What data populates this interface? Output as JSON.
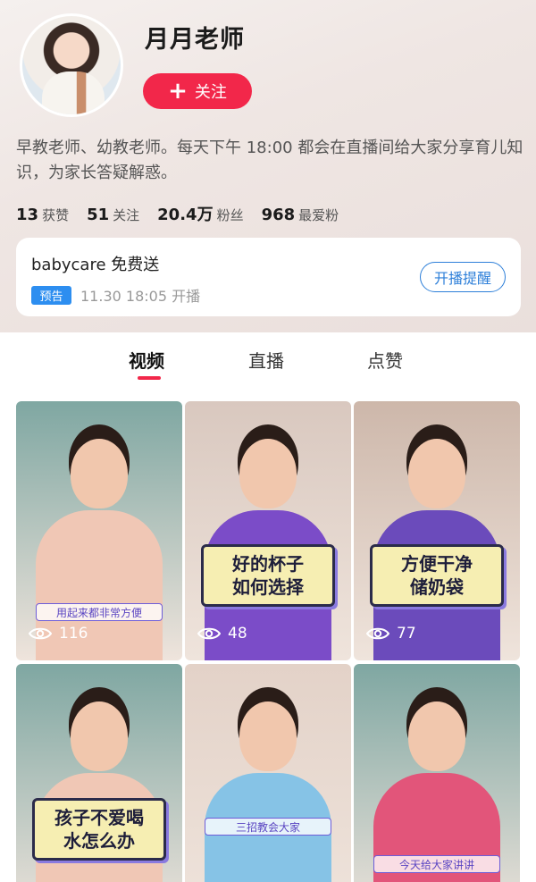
{
  "profile": {
    "name": "月月老师",
    "follow_label": "关注",
    "bio": "早教老师、幼教老师。每天下午 18:00 都会在直播间给大家分享育儿知识，为家长答疑解惑。",
    "stats": [
      {
        "value": "13",
        "label": "获赞"
      },
      {
        "value": "51",
        "label": "关注"
      },
      {
        "value": "20.4万",
        "label": "粉丝"
      },
      {
        "value": "968",
        "label": "最爱粉"
      }
    ]
  },
  "live": {
    "title": "babycare 免费送",
    "badge": "预告",
    "time": "11.30 18:05 开播",
    "remind_label": "开播提醒"
  },
  "tabs": [
    {
      "label": "视频",
      "active": true
    },
    {
      "label": "直播",
      "active": false
    },
    {
      "label": "点赞",
      "active": false
    }
  ],
  "videos": [
    {
      "caption": "",
      "small_caption": "用起来都非常方便",
      "views": "116",
      "bg": "#7fa7a2",
      "torso": "#f0c7b5"
    },
    {
      "caption": "好的杯子\n如何选择",
      "small_caption": "",
      "views": "48",
      "bg": "#d9c8bf",
      "torso": "#7b4cc8"
    },
    {
      "caption": "方便干净\n储奶袋",
      "small_caption": "",
      "views": "77",
      "bg": "#cdb7aa",
      "torso": "#6b4bbb"
    },
    {
      "caption": "孩子不爱喝\n水怎么办",
      "small_caption": "",
      "views": "",
      "bg": "#7fa7a2",
      "torso": "#f0c7b5"
    },
    {
      "caption": "",
      "small_caption": "三招教会大家",
      "views": "",
      "bg": "#e3d2c8",
      "torso": "#86c3e6"
    },
    {
      "caption": "",
      "small_caption": "今天给大家讲讲",
      "views": "",
      "bg": "#7fa7a2",
      "torso": "#e2557a"
    }
  ]
}
